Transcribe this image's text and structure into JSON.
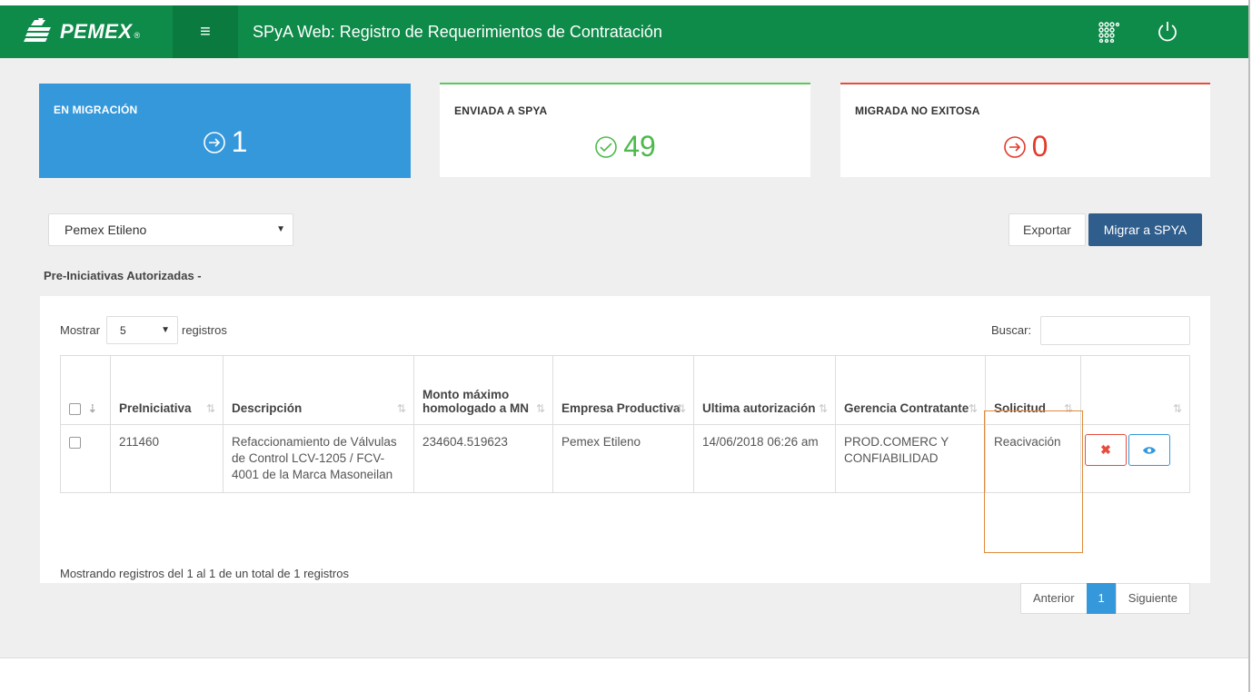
{
  "header": {
    "brand_name": "PEMEX",
    "brand_reg": "®",
    "menu_glyph": "≡",
    "app_title": "SPyA Web: Registro de Requerimientos de Contratación",
    "icons": [
      "apps-grid-icon",
      "power-icon"
    ]
  },
  "tiles": [
    {
      "label": "EN MIGRACIÓN",
      "value": "1",
      "icon": "arrow-right-circle-icon",
      "color": "#3498db"
    },
    {
      "label": "ENVIADA A SPYA",
      "value": "49",
      "icon": "check-circle-icon",
      "color": "#4cba4c"
    },
    {
      "label": "MIGRADA NO EXITOSA",
      "value": "0",
      "icon": "arrow-right-circle-icon",
      "color": "#e23b2c"
    }
  ],
  "filters": {
    "company_selected": "Pemex Etileno",
    "export_label": "Exportar",
    "migrate_label": "Migrar a SPYA"
  },
  "section_title": "Pre-Iniciativas Autorizadas -",
  "table": {
    "show_label": "Mostrar",
    "page_length": "5",
    "records_label": "registros",
    "search_label": "Buscar:",
    "columns": [
      "",
      "PreIniciativa",
      "Descripción",
      "Monto máximo homologado a MN",
      "Empresa Productiva",
      "Ultima autorización",
      "Gerencia Contratante",
      "Solicitud",
      ""
    ],
    "rows": [
      {
        "preiniciativa": "211460",
        "descripcion": "Refaccionamiento de Válvulas de Control LCV-1205 / FCV-4001 de la Marca Masoneilan",
        "monto": "234604.519623",
        "empresa": "Pemex Etileno",
        "ultima_autorizacion": "14/06/2018 06:26 am",
        "gerencia": "PROD.COMERC Y CONFIABILIDAD",
        "solicitud": "Reacivación",
        "actions": {
          "delete_glyph": "✖",
          "view_glyph": "👁"
        }
      }
    ],
    "info": "Mostrando registros del 1 al 1 de un total de 1 registros",
    "pagination": {
      "prev": "Anterior",
      "current": "1",
      "next": "Siguiente"
    }
  },
  "colors": {
    "header_green": "#0e8a49",
    "tile_blue": "#3498db",
    "success_green": "#4cba4c",
    "danger_red": "#e23b2c",
    "primary_dark_blue": "#2f5d8c",
    "highlight_orange": "#e08a3c"
  }
}
